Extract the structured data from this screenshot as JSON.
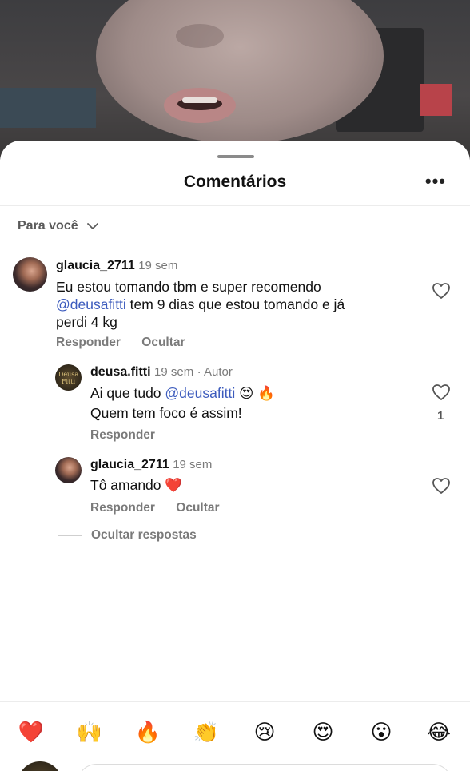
{
  "sheet": {
    "title": "Comentários",
    "more_label": "•••",
    "filter_label": "Para você"
  },
  "comments": [
    {
      "user": "glaucia_2711",
      "time": "19 sem",
      "text_before": "Eu estou tomando tbm e super recomendo",
      "mention": "@deusafitti",
      "text_after": " tem 9 dias que estou tomando e já",
      "text_line3": "perdi 4 kg",
      "reply_label": "Responder",
      "hide_label": "Ocultar"
    },
    {
      "user": "deusa.fitti",
      "time": "19 sem",
      "author_tag": "· Autor",
      "avatar_text": "Deusa Fitti",
      "line1_before": "Ai que tudo ",
      "mention": "@deusafitti",
      "line1_emojis": " 😍 🔥",
      "line2": "Quem tem foco é assim!",
      "reply_label": "Responder",
      "like_count": "1"
    },
    {
      "user": "glaucia_2711",
      "time": "19 sem",
      "text": "Tô amando ❤️",
      "reply_label": "Responder",
      "hide_label": "Ocultar"
    }
  ],
  "hide_replies_label": "Ocultar respostas",
  "emoji_bar": [
    "❤️",
    "🙌",
    "🔥",
    "👏",
    "😢",
    "😍",
    "😮",
    "😂"
  ]
}
